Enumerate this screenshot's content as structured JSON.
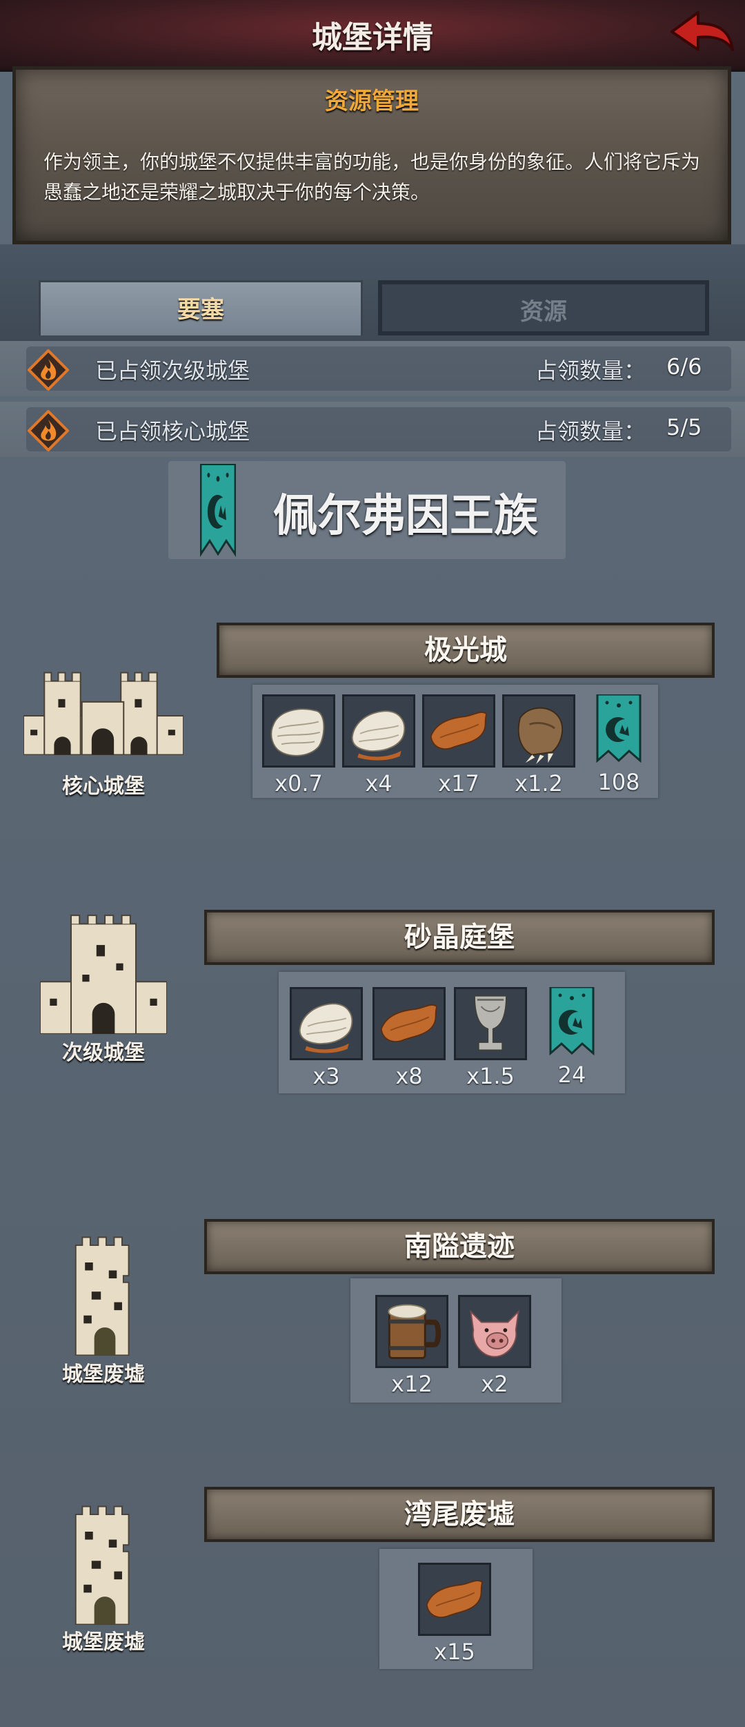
{
  "header": {
    "title": "城堡详情"
  },
  "info": {
    "title": "资源管理",
    "text": "作为领主，你的城堡不仅提供丰富的功能，也是你身份的象征。人们将它斥为愚蠢之地还是荣耀之城取决于你的每个决策。"
  },
  "tabs": [
    {
      "label": "要塞",
      "active": true
    },
    {
      "label": "资源",
      "active": false
    }
  ],
  "summary": [
    {
      "label": "已占领次级城堡",
      "count_label": "占领数量：",
      "count": "6/6",
      "icon": "flame-icon"
    },
    {
      "label": "已占领核心城堡",
      "count_label": "占领数量：",
      "count": "5/5",
      "icon": "flame-icon"
    }
  ],
  "faction": {
    "name": "佩尔弗因王族",
    "color": "#2aa39a"
  },
  "castles": [
    {
      "type": "核心城堡",
      "name": "极光城",
      "resources": [
        {
          "icon": "white-pelt-icon",
          "count": "x0.7"
        },
        {
          "icon": "white-fur-icon",
          "count": "x4"
        },
        {
          "icon": "brown-leather-icon",
          "count": "x17"
        },
        {
          "icon": "claw-paw-icon",
          "count": "x1.2"
        },
        {
          "icon": "faction-banner-icon",
          "count": "108"
        }
      ]
    },
    {
      "type": "次级城堡",
      "name": "砂晶庭堡",
      "resources": [
        {
          "icon": "white-fur-icon",
          "count": "x3"
        },
        {
          "icon": "brown-leather-icon",
          "count": "x8"
        },
        {
          "icon": "goblet-icon",
          "count": "x1.5"
        },
        {
          "icon": "faction-banner-icon",
          "count": "24"
        }
      ]
    },
    {
      "type": "城堡废墟",
      "name": "南隘遗迹",
      "resources": [
        {
          "icon": "ale-mug-icon",
          "count": "x12"
        },
        {
          "icon": "pig-head-icon",
          "count": "x2"
        }
      ]
    },
    {
      "type": "城堡废墟",
      "name": "湾尾废墟",
      "resources": [
        {
          "icon": "brown-leather-icon",
          "count": "x15"
        }
      ]
    }
  ]
}
